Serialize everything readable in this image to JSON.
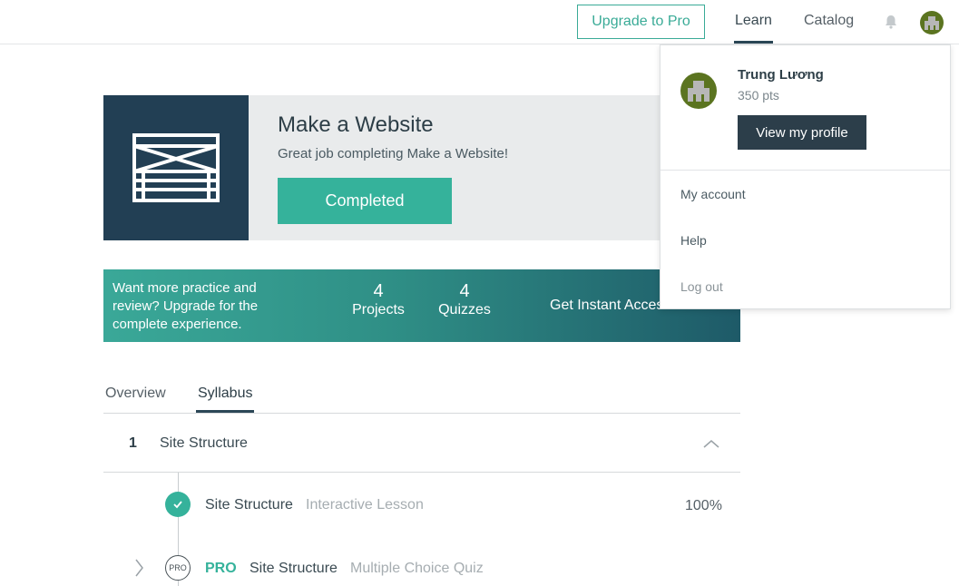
{
  "nav": {
    "upgrade_label": "Upgrade to Pro",
    "learn_label": "Learn",
    "catalog_label": "Catalog",
    "bell_icon": "bell-icon",
    "avatar_icon": "avatar-icon"
  },
  "course": {
    "title": "Make a Website",
    "subtitle": "Great job completing Make a Website!",
    "completed_label": "Completed"
  },
  "banner": {
    "text": "Want more practice and review? Upgrade for the complete experience.",
    "projects_count": "4",
    "projects_label": "Projects",
    "quizzes_count": "4",
    "quizzes_label": "Quizzes",
    "cta_label": "Get Instant Access"
  },
  "tabs": [
    {
      "label": "Overview",
      "active": false
    },
    {
      "label": "Syllabus",
      "active": true
    }
  ],
  "syllabus": {
    "section_number": "1",
    "section_title": "Site Structure",
    "lessons": [
      {
        "title": "Site Structure",
        "type": "Interactive Lesson",
        "progress": "100%",
        "status": "completed"
      },
      {
        "badge": "PRO",
        "label": "PRO",
        "title": "Site Structure",
        "type": "Multiple Choice Quiz",
        "status": "locked"
      }
    ]
  },
  "dropdown": {
    "user_name": "Trung Lương",
    "points": "350 pts",
    "profile_button": "View my profile",
    "items": [
      "My account",
      "Help",
      "Log out"
    ]
  },
  "colors": {
    "accent": "#35b29b",
    "navy": "#223f54",
    "dark_button": "#2c3e4a",
    "avatar_green": "#5b7420"
  }
}
